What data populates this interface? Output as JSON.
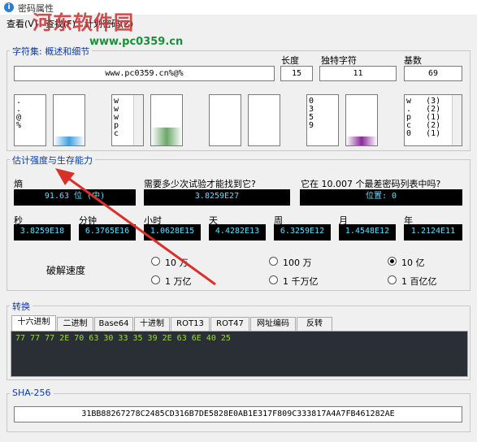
{
  "window": {
    "title": "密码属性"
  },
  "watermark": {
    "text": "河东软件园",
    "url": "www.pc0359.cn"
  },
  "menu": {
    "items": [
      "查看(V)",
      "查找(F)",
      "计划密码(Z)"
    ]
  },
  "charset_row": {
    "label": "字符集: 概述和细节",
    "length_label": "长度",
    "unique_label": "独特字符",
    "base_label": "基数",
    "password": "www.pc0359.cn%@%",
    "length": "15",
    "unique": "11",
    "base": "69"
  },
  "lists": {
    "list1": [
      ".",
      ".",
      "@",
      "%"
    ],
    "list2": [
      "w",
      "w",
      "w",
      "p",
      "c"
    ],
    "list3": [
      "0",
      "3",
      "5",
      "9"
    ],
    "list4": [
      "w   (3)",
      ".   (2)",
      "p   (1)",
      "c   (2)",
      "0   (1)"
    ]
  },
  "meters": {
    "m1": 0.18,
    "m2": 0.35,
    "m3": 0.18
  },
  "colors": {
    "meter1": "#3fa0e0",
    "meter2": "#6aa86a",
    "meter3": "#8a2a9a",
    "label_blue": "#0b3aa8"
  },
  "strength": {
    "title": "估计强度与生存能力",
    "entropy_label": "熵",
    "entropy_value": "91.63 位 (中)",
    "tries_label": "需要多少次试验才能找到它?",
    "tries_value": "3.8259E27",
    "list_label": "它在 10.007 个最差密码列表中吗?",
    "list_value": "位置: 0",
    "units": [
      {
        "label": "秒",
        "value": "3.8259E18"
      },
      {
        "label": "分钟",
        "value": "6.3765E16"
      },
      {
        "label": "小时",
        "value": "1.0628E15"
      },
      {
        "label": "天",
        "value": "4.4282E13"
      },
      {
        "label": "周",
        "value": "6.3259E12"
      },
      {
        "label": "月",
        "value": "1.4548E12"
      },
      {
        "label": "年",
        "value": "1.2124E11"
      }
    ],
    "speed_label": "破解速度",
    "speeds": [
      {
        "label": "10 万",
        "checked": false
      },
      {
        "label": "100 万",
        "checked": false
      },
      {
        "label": "10 亿",
        "checked": true
      },
      {
        "label": "1 万亿",
        "checked": false
      },
      {
        "label": "1 千万亿",
        "checked": false
      },
      {
        "label": "1 百亿亿",
        "checked": false
      }
    ]
  },
  "convert": {
    "title": "转换",
    "tabs": [
      "十六进制",
      "二进制",
      "Base64",
      "十进制",
      "ROT13",
      "ROT47",
      "网址编码",
      "反转"
    ],
    "active_tab": "十六进制",
    "output": "77 77 77 2E 70 63 30 33 35 39 2E 63 6E 40 25"
  },
  "sha": {
    "title": "SHA-256",
    "value": "31BB88267278C2485CD316B7DE5828E0AB1E317F809C333817A4A7FB461282AE"
  }
}
